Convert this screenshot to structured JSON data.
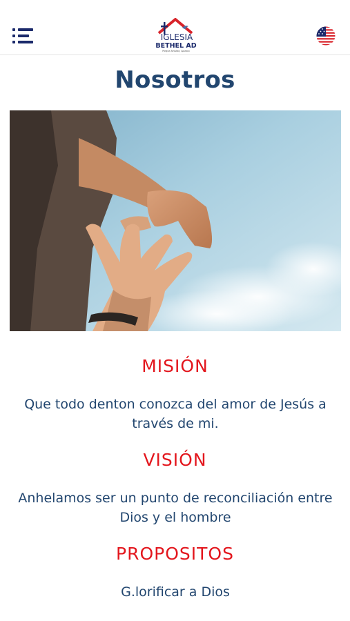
{
  "header": {
    "logo_line1": "IGLESIA",
    "logo_line2": "BETHEL AD",
    "logo_tagline": "Parque Amistad, Apizaco"
  },
  "page": {
    "title": "Nosotros"
  },
  "colors": {
    "heading_blue": "#22466f",
    "accent_red": "#e3161d",
    "menu_navy": "#1b2a6b"
  },
  "icons": {
    "menu": "menu-icon",
    "language": "us-flag-icon"
  },
  "sections": [
    {
      "heading": "MISIÓN",
      "text": "Que todo denton conozca del amor de Jesús a través de mi."
    },
    {
      "heading": "VISIÓN",
      "text": "Anhelamos ser un punto de reconciliación entre Dios y el hombre"
    },
    {
      "heading": "PROPOSITOS",
      "items": [
        "G.lorificar a Dios"
      ]
    }
  ]
}
